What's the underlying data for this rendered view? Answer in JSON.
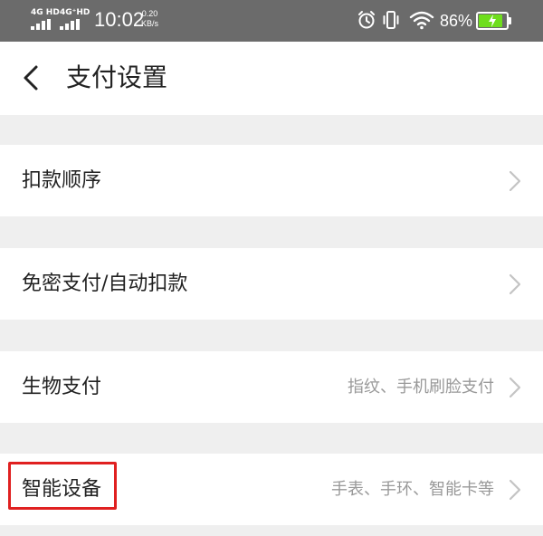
{
  "status_bar": {
    "network_1": "4G HD",
    "network_2": "4G⁺HD",
    "time": "10:02",
    "speed_value": "0.20",
    "speed_unit": "KB/s",
    "icons": [
      "alarm-icon",
      "vibrate-icon",
      "wifi-icon",
      "battery-icon"
    ],
    "battery_percent": "86%",
    "battery_level": 0.86,
    "battery_color": "#6fde1d"
  },
  "header": {
    "back_icon": "chevron-left-icon",
    "title": "支付设置"
  },
  "settings": {
    "items": [
      {
        "label": "扣款顺序",
        "value": ""
      },
      {
        "label": "免密支付/自动扣款",
        "value": ""
      },
      {
        "label": "生物支付",
        "value": "指纹、手机刷脸支付"
      },
      {
        "label": "智能设备",
        "value": "手表、手环、智能卡等",
        "highlighted": true
      }
    ]
  },
  "colors": {
    "status_bar_bg": "#6b6b6b",
    "page_bg": "#efefef",
    "row_bg": "#ffffff",
    "highlight": "#e02020",
    "secondary_text": "#999999"
  }
}
